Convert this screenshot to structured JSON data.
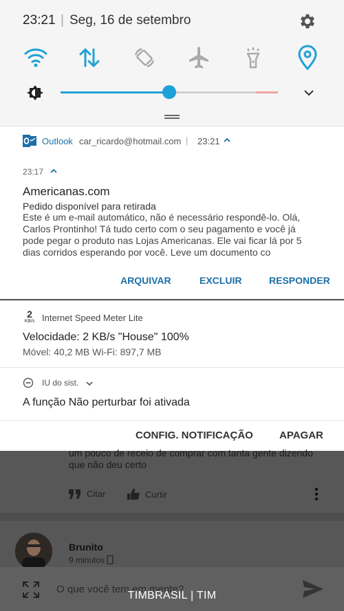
{
  "status": {
    "time": "23:21",
    "date": "Seg, 16 de setembro"
  },
  "quick_settings": {
    "icons": [
      "wifi-icon",
      "data-transfer-icon",
      "auto-rotate-icon",
      "airplane-mode-icon",
      "flashlight-icon",
      "location-icon"
    ],
    "brightness_level": 0.5
  },
  "outlook": {
    "app": "Outlook",
    "account": "car_ricardo@hotmail.com",
    "time": "23:21",
    "message": {
      "time": "23:17",
      "sender": "Americanas.com",
      "subject": "Pedido disponível para retirada",
      "body": "Este é um e-mail automático, não é necessário respondê-lo. Olá, Carlos Prontinho! Tá tudo certo com o seu pagamento e você já pode pegar o produto nas Lojas Americanas. Ele vai ficar lá por 5 dias corridos esperando por você. Leve um documento co",
      "actions": [
        "ARQUIVAR",
        "EXCLUIR",
        "RESPONDER"
      ]
    }
  },
  "speed_meter": {
    "badge_value": "2",
    "badge_unit": "KB/s",
    "app": "Internet Speed Meter Lite",
    "line1": "Velocidade: 2 KB/s   \"House\" 100%",
    "line2": "Móvel: 40,2 MB   Wi-Fi: 897,7 MB"
  },
  "system": {
    "app": "IU do sist.",
    "text": "A função Não perturbar foi ativada"
  },
  "footer": {
    "config": "CONFIG. NOTIFICAÇÃO",
    "clear": "APAGAR"
  },
  "background": {
    "comment_text": "um pouco de receio de comprar com tanta gente dizendo que não deu certo",
    "quote_label": "Citar",
    "like_label": "Curtir",
    "next_user": "Brunito",
    "next_time": "9 minutos",
    "composer_placeholder": "O que você tem em mente?"
  },
  "carrier": "TIMBRASIL | TIM",
  "colors": {
    "accent": "#1ea1d8",
    "link": "#1c6fa8"
  }
}
